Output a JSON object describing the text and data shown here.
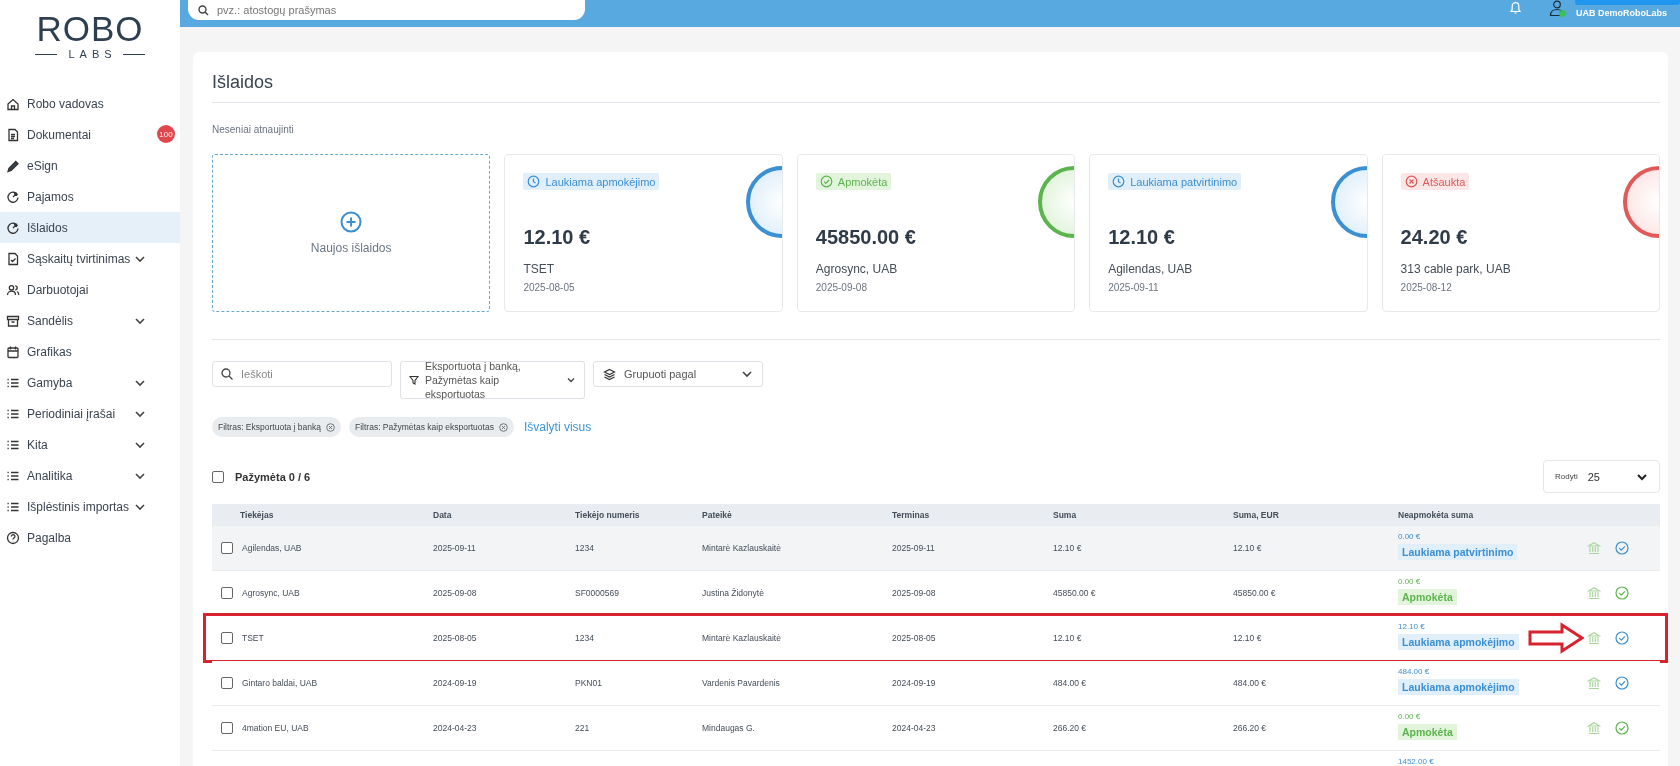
{
  "logo": {
    "title": "ROBO",
    "subtitle": "LABS"
  },
  "sidebar": {
    "items": [
      {
        "label": "Robo vadovas",
        "expandable": false,
        "selected": false
      },
      {
        "label": "Dokumentai",
        "expandable": false,
        "selected": false,
        "badge": "100"
      },
      {
        "label": "eSign",
        "expandable": false,
        "selected": false
      },
      {
        "label": "Pajamos",
        "expandable": false,
        "selected": false
      },
      {
        "label": "Išlaidos",
        "expandable": false,
        "selected": true
      },
      {
        "label": "Sąskaitų tvirtinimas",
        "expandable": true,
        "selected": false
      },
      {
        "label": "Darbuotojai",
        "expandable": false,
        "selected": false
      },
      {
        "label": "Sandėlis",
        "expandable": true,
        "selected": false
      },
      {
        "label": "Grafikas",
        "expandable": false,
        "selected": false
      },
      {
        "label": "Gamyba",
        "expandable": true,
        "selected": false
      },
      {
        "label": "Periodiniai įrašai",
        "expandable": true,
        "selected": false
      },
      {
        "label": "Kita",
        "expandable": true,
        "selected": false
      },
      {
        "label": "Analitika",
        "expandable": true,
        "selected": false
      },
      {
        "label": "Išplėstinis importas",
        "expandable": true,
        "selected": false
      },
      {
        "label": "Pagalba",
        "expandable": false,
        "selected": false
      }
    ]
  },
  "topbar": {
    "search": {
      "placeholder": "pvz.: atostogų prašymas"
    },
    "company": "UAB DemoRoboLabs",
    "online": true
  },
  "page": {
    "title": "Išlaidos",
    "recent_label": "Neseniai atnaujinti",
    "new_card": {
      "label": "Naujos išlaidos"
    },
    "recent": [
      {
        "status": {
          "kind": "awaiting_payment",
          "label": "Laukiama apmokėjimo"
        },
        "amount": "12.10 €",
        "supplier": "TSET",
        "date": "2025-08-05"
      },
      {
        "status": {
          "kind": "paid",
          "label": "Apmokėta"
        },
        "amount": "45850.00 €",
        "supplier": "Agrosync, UAB",
        "date": "2025-09-08"
      },
      {
        "status": {
          "kind": "awaiting_approval",
          "label": "Laukiama patvirtinimo"
        },
        "amount": "12.10 €",
        "supplier": "Agilendas, UAB",
        "date": "2025-09-11"
      },
      {
        "status": {
          "kind": "cancelled",
          "label": "Atšaukta"
        },
        "amount": "24.20 €",
        "supplier": "313 cable park, UAB",
        "date": "2025-08-12"
      }
    ],
    "search": {
      "placeholder": "Ieškoti"
    },
    "filter_select": {
      "value": "Eksportuota į banką, Pažymėtas kaip eksportuotas"
    },
    "group_select": {
      "value": "Grupuoti pagal"
    },
    "chips": [
      {
        "label": "Filtras: Eksportuota į banką"
      },
      {
        "label": "Filtras: Pažymėtas kaip eksportuotas"
      }
    ],
    "clear_all": "Išvalyti visus",
    "selection": {
      "label": "Pažymėta 0 / 6",
      "checked": false
    },
    "page_size": {
      "label": "Rodyti",
      "value": "25"
    }
  },
  "table": {
    "columns": [
      "Tiekėjas",
      "Data",
      "Tiekėjo numeris",
      "Pateikė",
      "Terminas",
      "Suma",
      "Suma, EUR",
      "Neapmokėta suma"
    ],
    "rows": [
      {
        "checked": false,
        "hovered": true,
        "annotated": false,
        "cells": [
          "Agilendas, UAB",
          "2025-09-11",
          "1234",
          "Mintarė Kazlauskaitė",
          "2025-09-11",
          "12.10 €",
          "12.10 €"
        ],
        "unpaid": "0.00 €",
        "status": {
          "kind": "awaiting_approval",
          "label": "Laukiama patvirtinimo"
        }
      },
      {
        "checked": false,
        "hovered": false,
        "annotated": false,
        "cells": [
          "Agrosync, UAB",
          "2025-09-08",
          "SF0000569",
          "Justina Židonytė",
          "2025-09-08",
          "45850.00 €",
          "45850.00 €"
        ],
        "unpaid": "0.00 €",
        "status": {
          "kind": "paid",
          "label": "Apmokėta"
        }
      },
      {
        "checked": false,
        "hovered": false,
        "annotated": true,
        "cells": [
          "TSET",
          "2025-08-05",
          "1234",
          "Mintarė Kazlauskaitė",
          "2025-08-05",
          "12.10 €",
          "12.10 €"
        ],
        "unpaid": "12.10 €",
        "status": {
          "kind": "awaiting_payment",
          "label": "Laukiama apmokėjimo"
        }
      },
      {
        "checked": false,
        "hovered": false,
        "annotated": false,
        "cells": [
          "Gintaro baldai, UAB",
          "2024-09-19",
          "PKN01",
          "Vardenis Pavardenis",
          "2024-09-19",
          "484.00 €",
          "484.00 €"
        ],
        "unpaid": "484.00 €",
        "status": {
          "kind": "awaiting_payment",
          "label": "Laukiama apmokėjimo"
        }
      },
      {
        "checked": false,
        "hovered": false,
        "annotated": false,
        "cells": [
          "4mation EU, UAB",
          "2024-04-23",
          "221",
          "Mindaugas G.",
          "2024-04-23",
          "266.20 €",
          "266.20 €"
        ],
        "unpaid": "0.00 €",
        "status": {
          "kind": "paid",
          "label": "Apmokėta"
        }
      },
      {
        "unpaid": "1452.00 €",
        "status": {
          "kind": "awaiting_payment"
        }
      }
    ]
  }
}
